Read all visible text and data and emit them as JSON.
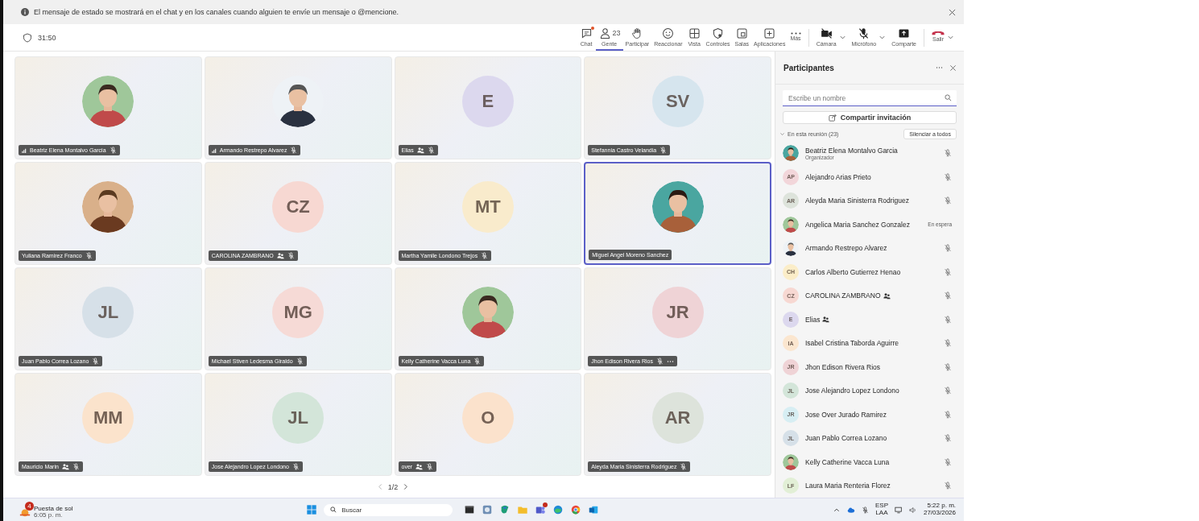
{
  "banner": {
    "text": "El mensaje de estado se mostrará en el chat y en los canales cuando alguien te envíe un mensaje o @mencione."
  },
  "meeting": {
    "timer": "31:50"
  },
  "toolbar": [
    {
      "kind": "chat",
      "label": "Chat",
      "notify": true,
      "selected": false,
      "dropdown": false
    },
    {
      "kind": "people",
      "label": "Gente",
      "count": "23",
      "notify": false,
      "selected": true,
      "dropdown": false
    },
    {
      "kind": "hand",
      "label": "Participar",
      "notify": false,
      "selected": false,
      "dropdown": false
    },
    {
      "kind": "emoji",
      "label": "Reaccionar",
      "notify": false,
      "selected": false,
      "dropdown": false
    },
    {
      "kind": "grid",
      "label": "Vista",
      "notify": false,
      "selected": false,
      "dropdown": false
    },
    {
      "kind": "shield",
      "label": "Controles",
      "notify": false,
      "selected": false,
      "dropdown": false
    },
    {
      "kind": "rooms",
      "label": "Salas",
      "notify": false,
      "selected": false,
      "dropdown": false
    },
    {
      "kind": "apps",
      "label": "Aplicaciones",
      "notify": false,
      "selected": false,
      "dropdown": false
    },
    {
      "kind": "more",
      "label": "Más",
      "notify": false,
      "selected": false,
      "dropdown": false
    },
    {
      "kind": "camera",
      "label": "Cámara",
      "notify": false,
      "selected": false,
      "dropdown": true
    },
    {
      "kind": "mic",
      "label": "Micrófono",
      "notify": false,
      "selected": false,
      "dropdown": true
    },
    {
      "kind": "share",
      "label": "Comparte",
      "notify": false,
      "selected": false,
      "dropdown": false
    },
    {
      "kind": "leave",
      "label": "Salir",
      "notify": false,
      "selected": false,
      "dropdown": true
    }
  ],
  "tiles": [
    {
      "name": "Beatriz Elena Montalvo Garcia",
      "signal": true,
      "badge": false,
      "muted": true,
      "selected": false,
      "more": false
    },
    {
      "name": "Armando Restrepo Alvarez",
      "signal": true,
      "badge": false,
      "muted": true,
      "selected": false,
      "more": false
    },
    {
      "name": "Elias",
      "kind": "initials",
      "initials": "E",
      "color": "#dcd8ee",
      "signal": false,
      "badge": true,
      "muted": true,
      "selected": false,
      "more": false
    },
    {
      "name": "Stefannia Castro Velandia",
      "kind": "initials",
      "initials": "SV",
      "color": "#d6e5ee",
      "signal": false,
      "badge": false,
      "muted": true,
      "selected": false,
      "more": false
    },
    {
      "name": "Yuliana Ramirez Franco",
      "signal": false,
      "badge": false,
      "muted": true,
      "selected": false,
      "more": false
    },
    {
      "name": "CAROLINA ZAMBRANO",
      "kind": "initials",
      "initials": "CZ",
      "color": "#f7d8d2",
      "signal": false,
      "badge": true,
      "muted": true,
      "selected": false,
      "more": false
    },
    {
      "name": "Martha Yamile Londono Trejos",
      "kind": "initials",
      "initials": "MT",
      "color": "#f9ebcc",
      "signal": false,
      "badge": false,
      "muted": true,
      "selected": false,
      "more": false
    },
    {
      "name": "Miguel Angel Moreno Sanchez",
      "signal": false,
      "badge": false,
      "muted": false,
      "selected": true,
      "more": false
    },
    {
      "name": "Juan Pablo Correa Lozano",
      "kind": "initials",
      "initials": "JL",
      "color": "#d6e0e8",
      "signal": false,
      "badge": false,
      "muted": true,
      "selected": false,
      "more": false
    },
    {
      "name": "Michael Stiven Ledesma Giraldo",
      "kind": "initials",
      "initials": "MG",
      "color": "#f6dad6",
      "signal": false,
      "badge": false,
      "muted": true,
      "selected": false,
      "more": false
    },
    {
      "name": "Kelly Catherine Vacca Luna",
      "signal": false,
      "badge": false,
      "muted": true,
      "selected": false,
      "more": false
    },
    {
      "name": "Jhon Edison Rivera Rios",
      "kind": "initials",
      "initials": "JR",
      "color": "#efd3d6",
      "signal": false,
      "badge": false,
      "muted": true,
      "selected": false,
      "more": true
    },
    {
      "name": "Mauricio Marin",
      "kind": "initials",
      "initials": "MM",
      "color": "#fbe3cc",
      "signal": false,
      "badge": true,
      "muted": true,
      "selected": false,
      "more": false
    },
    {
      "name": "Jose Alejandro Lopez Londono",
      "kind": "initials",
      "initials": "JL",
      "color": "#d3e5d9",
      "signal": false,
      "badge": false,
      "muted": true,
      "selected": false,
      "more": false
    },
    {
      "name": "over",
      "kind": "initials",
      "initials": "O",
      "color": "#fbe2cc",
      "signal": false,
      "badge": true,
      "muted": true,
      "selected": false,
      "more": false
    },
    {
      "name": "Aleyda Maria Sinisterra Rodriguez",
      "kind": "initials",
      "initials": "AR",
      "color": "#dde3db",
      "signal": false,
      "badge": false,
      "muted": true,
      "selected": false,
      "more": false
    }
  ],
  "pagination": {
    "page": "1/2"
  },
  "panel": {
    "title": "Participantes",
    "search": {
      "placeholder": "Escribe un nombre"
    },
    "share": "Compartir invitación",
    "section": {
      "label": "En esta reunión (23)",
      "expanded": true
    },
    "mute_all": "Silenciar a todos",
    "participants": [
      {
        "name": "Beatriz Elena Montalvo Garcia",
        "subtitle": "Organizador",
        "badge": false,
        "muted": true
      },
      {
        "name": "Alejandro Arias Prieto",
        "kind": "initials",
        "initials": "AP",
        "color": "#f2d6da",
        "badge": false,
        "muted": true
      },
      {
        "name": "Aleyda Maria Sinisterra Rodriguez",
        "kind": "initials",
        "initials": "AR",
        "color": "#dde3db",
        "badge": false,
        "muted": true
      },
      {
        "name": "Angelica Maria Sanchez Gonzalez",
        "badge": false,
        "muted": false,
        "status": "En espera"
      },
      {
        "name": "Armando Restrepo Alvarez",
        "badge": false,
        "muted": true
      },
      {
        "name": "Carlos Alberto Gutierrez Henao",
        "kind": "initials",
        "initials": "CH",
        "color": "#fbedc8",
        "badge": false,
        "muted": true
      },
      {
        "name": "CAROLINA ZAMBRANO",
        "kind": "initials",
        "initials": "CZ",
        "color": "#f7d8d2",
        "badge": true,
        "muted": true
      },
      {
        "name": "Elias",
        "kind": "initials",
        "initials": "E",
        "color": "#dcd8ee",
        "badge": true,
        "muted": true
      },
      {
        "name": "Isabel Cristina Taborda Aguirre",
        "kind": "initials",
        "initials": "IA",
        "color": "#fbe6cf",
        "badge": false,
        "muted": true
      },
      {
        "name": "Jhon Edison Rivera Rios",
        "kind": "initials",
        "initials": "JR",
        "color": "#efd3d6",
        "badge": false,
        "muted": true
      },
      {
        "name": "Jose Alejandro Lopez Londono",
        "kind": "initials",
        "initials": "JL",
        "color": "#d3e5d9",
        "badge": false,
        "muted": true
      },
      {
        "name": "Jose Over Jurado Ramirez",
        "kind": "initials",
        "initials": "JR",
        "color": "#d7eef3",
        "badge": false,
        "muted": true
      },
      {
        "name": "Juan Pablo Correa Lozano",
        "kind": "initials",
        "initials": "JL",
        "color": "#d6e0e8",
        "badge": false,
        "muted": true
      },
      {
        "name": "Kelly Catherine Vacca Luna",
        "badge": false,
        "muted": true
      },
      {
        "name": "Laura Maria Renteria Florez",
        "kind": "initials",
        "initials": "LF",
        "color": "#e2efd6",
        "badge": false,
        "muted": true
      }
    ]
  },
  "taskbar": {
    "weather": {
      "title": "Puesta de sol",
      "time": "6:05 p. m.",
      "badge": "4"
    },
    "search": "Buscar",
    "apps": [
      {
        "kind": "terminal",
        "alert": false
      },
      {
        "kind": "viewer",
        "alert": false
      },
      {
        "kind": "copilot",
        "alert": false
      },
      {
        "kind": "folder",
        "alert": false
      },
      {
        "kind": "teams",
        "alert": true
      },
      {
        "kind": "edge",
        "alert": false
      },
      {
        "kind": "chrome",
        "alert": false
      },
      {
        "kind": "outlook",
        "alert": false
      }
    ],
    "language": "ESP",
    "layout": "LAA",
    "time": "5:22 p. m.",
    "date": "27/03/2026"
  }
}
